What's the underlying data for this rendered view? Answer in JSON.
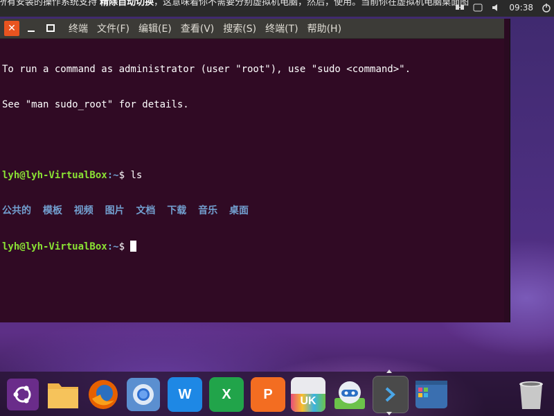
{
  "top_panel": {
    "notice_text": "所有安装的操作系统支持 ",
    "notice_bold": "精除自动切换",
    "notice_rest": "，这意味着你不需要分别虚拟机电脑，然后，使用。当前你在虚拟机电脑桌面图",
    "clock": "09:38"
  },
  "window": {
    "title_buttons": {
      "close": "✕",
      "minimize": "—",
      "maximize": "□"
    },
    "menu": [
      "终端",
      "文件(F)",
      "编辑(E)",
      "查看(V)",
      "搜索(S)",
      "终端(T)",
      "帮助(H)"
    ]
  },
  "terminal": {
    "motd_line1": "To run a command as administrator (user \"root\"), use \"sudo <command>\".",
    "motd_line2": "See \"man sudo_root\" for details.",
    "prompt_user": "lyh@lyh-VirtualBox",
    "prompt_path": ":~",
    "prompt_sign": "$ ",
    "command": "ls",
    "ls_output": [
      "公共的",
      "模板",
      "视频",
      "图片",
      "文档",
      "下载",
      "音乐",
      "桌面"
    ]
  },
  "dock": {
    "items": [
      {
        "name": "ubuntu-dash-icon",
        "label": "",
        "color": "#6a2c8a"
      },
      {
        "name": "files-icon",
        "label": "",
        "color": "#e8a33a"
      },
      {
        "name": "firefox-icon",
        "label": "",
        "color": "#e66000"
      },
      {
        "name": "chromium-icon",
        "label": "",
        "color": "#3b7ed2"
      },
      {
        "name": "wps-writer-icon",
        "label": "W",
        "color": "#1e88e5"
      },
      {
        "name": "wps-spreadsheet-icon",
        "label": "X",
        "color": "#21a44a"
      },
      {
        "name": "wps-presentation-icon",
        "label": "P",
        "color": "#f36d21"
      },
      {
        "name": "ubuntu-kylin-store-icon",
        "label": "UK",
        "color": "#e9e9ea"
      },
      {
        "name": "youker-assistant-icon",
        "label": "",
        "color": "#6cc24a"
      },
      {
        "name": "terminal-icon",
        "label": "›",
        "color": "#4a4a4a"
      },
      {
        "name": "workspace-switcher-icon",
        "label": "",
        "color": "#3a6fb0"
      },
      {
        "name": "trash-icon",
        "label": "",
        "color": "#8a8a8a"
      }
    ]
  }
}
